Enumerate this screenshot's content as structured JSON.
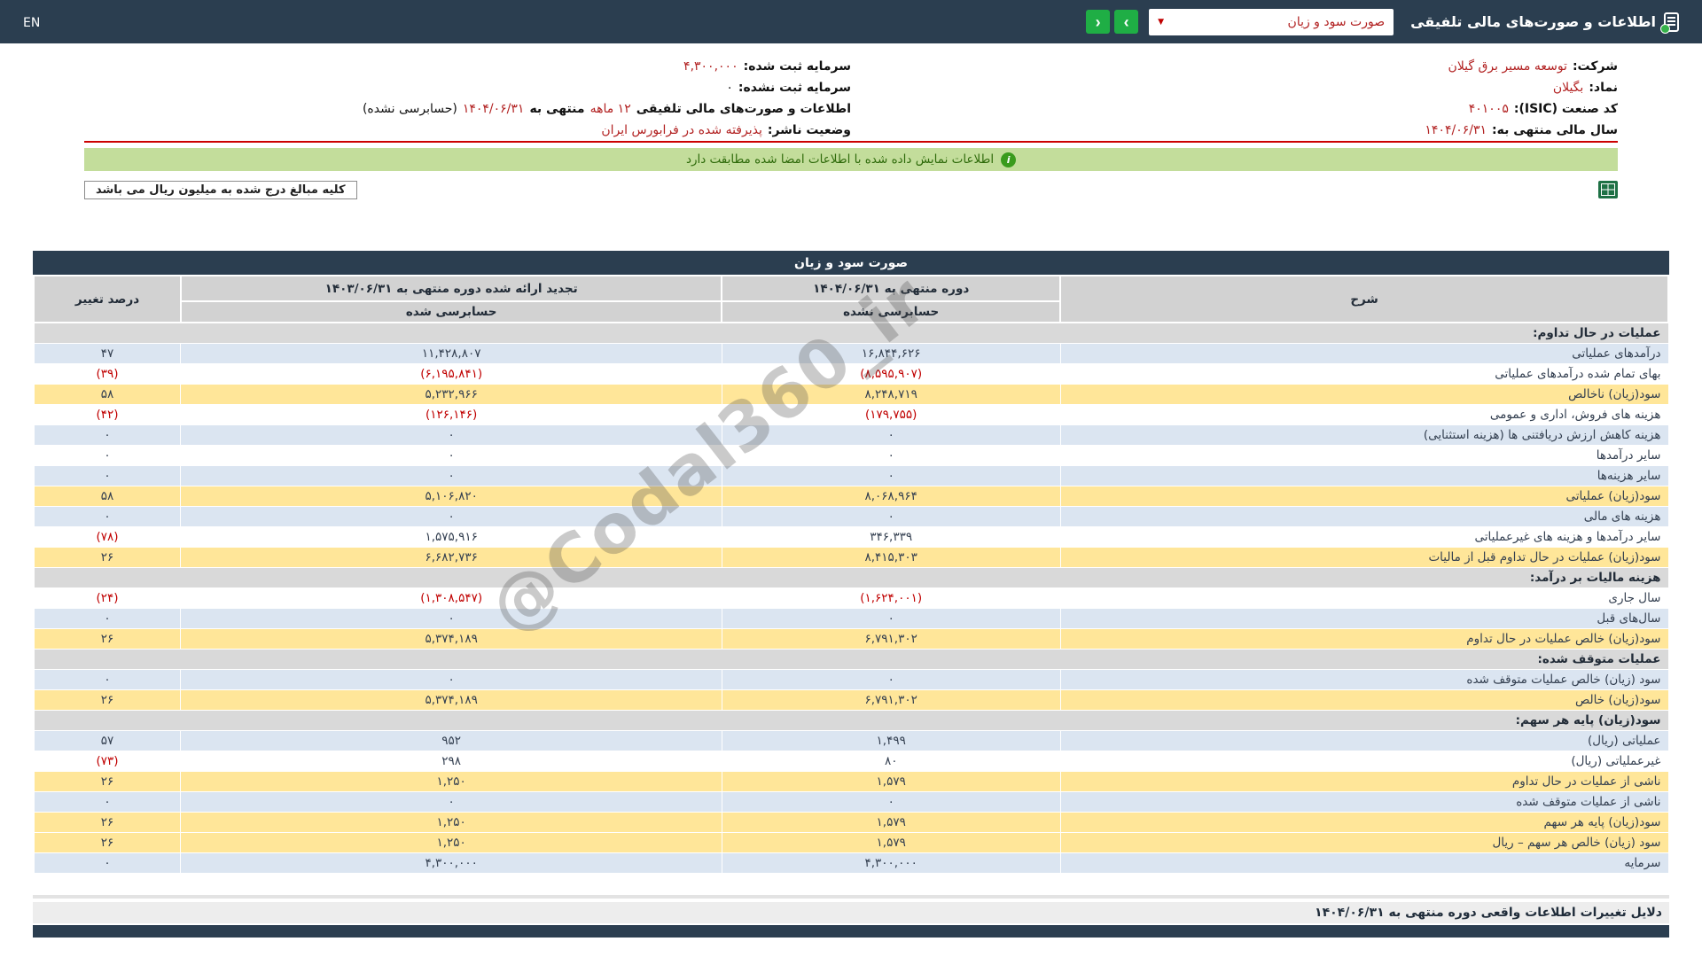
{
  "navbar": {
    "title": "اطلاعات و صورت‌های مالی تلفیقی",
    "statement_dropdown_value": "صورت سود و زیان",
    "caret_glyph": "▼",
    "next_arrow": "›",
    "prev_arrow": "‹",
    "en_label": "EN"
  },
  "company": {
    "right": [
      {
        "label": "شرکت:",
        "value": "توسعه مسیر برق گیلان"
      },
      {
        "label": "نماد:",
        "value": "بگیلان"
      },
      {
        "label": "کد صنعت (ISIC):",
        "value": "۴۰۱۰۰۵"
      },
      {
        "label": "سال مالی منتهی به:",
        "value": "۱۴۰۴/۰۶/۳۱"
      }
    ],
    "left": [
      {
        "label": "سرمایه ثبت شده:",
        "value": "۴,۳۰۰,۰۰۰"
      },
      {
        "label": "سرمایه ثبت نشده:",
        "value": "۰"
      },
      {
        "label": "وضعیت ناشر:",
        "value": "پذیرفته شده در فرابورس ایران"
      }
    ],
    "fiscal_note": {
      "p1": "اطلاعات و صورت‌های مالی تلفیقی ",
      "p2": "۱۲ ماهه",
      "p3": " منتهی به ",
      "p4": "۱۴۰۴/۰۶/۳۱",
      "p5": "(حسابرسی نشده)"
    }
  },
  "banner": {
    "text": "اطلاعات نمایش داده شده با اطلاعات امضا شده مطابقت دارد",
    "info_glyph": "i"
  },
  "note": {
    "text": "کلیه مبالغ درج شده به میلیون ریال می باشد"
  },
  "statement_table": {
    "title": "صورت سود و زیان",
    "headers": {
      "description": "شرح",
      "current_period": "دوره منتهی به ۱۴۰۴/۰۶/۳۱",
      "current_sub": "حسابرسی نشده",
      "restated_period": "تجدید ارائه شده دوره منتهی به ۱۴۰۳/۰۶/۳۱",
      "restated_sub": "حسابرسی شده",
      "change_percent": "درصد تغییر"
    },
    "rows": [
      {
        "type": "section",
        "label": "عملیات در حال تداوم:"
      },
      {
        "type": "data",
        "bg": "blue",
        "label": "درآمدهای عملیاتی",
        "current": "۱۶,۸۴۴,۶۲۶",
        "restated": "۱۱,۴۲۸,۸۰۷",
        "change": "۴۷"
      },
      {
        "type": "data",
        "bg": "white",
        "label": "بهای تمام شده درآمدهای عملیاتی",
        "current": "(۸,۵۹۵,۹۰۷)",
        "restated": "(۶,۱۹۵,۸۴۱)",
        "change": "(۳۹)"
      },
      {
        "type": "data",
        "bg": "yellow",
        "label": "سود(زیان) ناخالص",
        "current": "۸,۲۴۸,۷۱۹",
        "restated": "۵,۲۳۲,۹۶۶",
        "change": "۵۸"
      },
      {
        "type": "data",
        "bg": "white",
        "label": "هزینه های فروش، اداری و عمومی",
        "current": "(۱۷۹,۷۵۵)",
        "restated": "(۱۲۶,۱۴۶)",
        "change": "(۴۲)"
      },
      {
        "type": "data",
        "bg": "blue",
        "label": "هزینه کاهش ارزش دریافتنی ها (هزینه استثنایی)",
        "current": "۰",
        "restated": "۰",
        "change": "۰"
      },
      {
        "type": "data",
        "bg": "white",
        "label": "سایر درآمدها",
        "current": "۰",
        "restated": "۰",
        "change": "۰"
      },
      {
        "type": "data",
        "bg": "blue",
        "label": "سایر هزینه‌ها",
        "current": "۰",
        "restated": "۰",
        "change": "۰"
      },
      {
        "type": "data",
        "bg": "yellow",
        "label": "سود(زیان) عملیاتی",
        "current": "۸,۰۶۸,۹۶۴",
        "restated": "۵,۱۰۶,۸۲۰",
        "change": "۵۸"
      },
      {
        "type": "data",
        "bg": "blue",
        "label": "هزینه های مالی",
        "current": "۰",
        "restated": "۰",
        "change": "۰"
      },
      {
        "type": "data",
        "bg": "white",
        "label": "سایر درآمدها و هزینه های غیرعملیاتی",
        "current": "۳۴۶,۳۳۹",
        "restated": "۱,۵۷۵,۹۱۶",
        "change": "(۷۸)"
      },
      {
        "type": "data",
        "bg": "yellow",
        "label": "سود(زیان) عملیات در حال تداوم قبل از مالیات",
        "current": "۸,۴۱۵,۳۰۳",
        "restated": "۶,۶۸۲,۷۳۶",
        "change": "۲۶"
      },
      {
        "type": "section",
        "label": "هزینه مالیات بر درآمد:"
      },
      {
        "type": "data",
        "bg": "white",
        "label": "سال جاری",
        "current": "(۱,۶۲۴,۰۰۱)",
        "restated": "(۱,۳۰۸,۵۴۷)",
        "change": "(۲۴)"
      },
      {
        "type": "data",
        "bg": "blue",
        "label": "سال‌های قبل",
        "current": "۰",
        "restated": "۰",
        "change": "۰"
      },
      {
        "type": "data",
        "bg": "yellow",
        "label": "سود(زیان) خالص عملیات در حال تداوم",
        "current": "۶,۷۹۱,۳۰۲",
        "restated": "۵,۳۷۴,۱۸۹",
        "change": "۲۶"
      },
      {
        "type": "section",
        "label": "عملیات متوقف شده:"
      },
      {
        "type": "data",
        "bg": "blue",
        "label": "سود (زیان) خالص عملیات متوقف شده",
        "current": "۰",
        "restated": "۰",
        "change": "۰"
      },
      {
        "type": "data",
        "bg": "yellow",
        "label": "سود(زیان) خالص",
        "current": "۶,۷۹۱,۳۰۲",
        "restated": "۵,۳۷۴,۱۸۹",
        "change": "۲۶"
      },
      {
        "type": "section",
        "label": "سود(زیان) پایه هر سهم:"
      },
      {
        "type": "data",
        "bg": "blue",
        "label": "عملیاتی (ریال)",
        "current": "۱,۴۹۹",
        "restated": "۹۵۲",
        "change": "۵۷"
      },
      {
        "type": "data",
        "bg": "white",
        "label": "غیرعملیاتی (ریال)",
        "current": "۸۰",
        "restated": "۲۹۸",
        "change": "(۷۳)"
      },
      {
        "type": "data",
        "bg": "yellow",
        "label": "ناشی از عملیات در حال تداوم",
        "current": "۱,۵۷۹",
        "restated": "۱,۲۵۰",
        "change": "۲۶"
      },
      {
        "type": "data",
        "bg": "blue",
        "label": "ناشی از عملیات متوقف شده",
        "current": "۰",
        "restated": "۰",
        "change": "۰"
      },
      {
        "type": "data",
        "bg": "yellow",
        "label": "سود(زیان) پایه هر سهم",
        "current": "۱,۵۷۹",
        "restated": "۱,۲۵۰",
        "change": "۲۶"
      },
      {
        "type": "data",
        "bg": "yellow",
        "label": "سود (زیان) خالص هر سهم – ریال",
        "current": "۱,۵۷۹",
        "restated": "۱,۲۵۰",
        "change": "۲۶"
      },
      {
        "type": "data",
        "bg": "blue",
        "label": "سرمایه",
        "current": "۴,۳۰۰,۰۰۰",
        "restated": "۴,۳۰۰,۰۰۰",
        "change": "۰"
      }
    ]
  },
  "watermark": "@Codal360_ir",
  "footer": {
    "title": "دلایل تغییرات اطلاعات واقعی دوره منتهی به ۱۴۰۴/۰۶/۳۱"
  }
}
